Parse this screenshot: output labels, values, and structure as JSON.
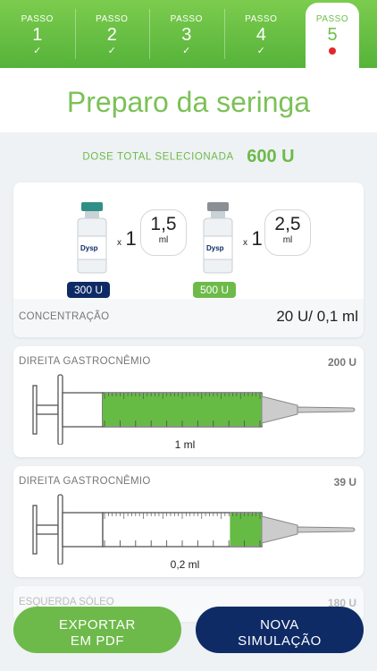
{
  "steps": [
    {
      "label": "PASSO",
      "number": "1",
      "mark": "✓"
    },
    {
      "label": "PASSO",
      "number": "2",
      "mark": "✓"
    },
    {
      "label": "PASSO",
      "number": "3",
      "mark": "✓"
    },
    {
      "label": "PASSO",
      "number": "4",
      "mark": "✓"
    },
    {
      "label": "PASSO",
      "number": "5"
    }
  ],
  "title": "Preparo da seringa",
  "dose": {
    "label": "DOSE TOTAL SELECIONADA",
    "value": "600 U"
  },
  "vials": [
    {
      "badge": "300 U",
      "badge_color": "#0f2b66",
      "cap_color": "#2f8f86",
      "x": "x",
      "count": "1",
      "volume": "1,5",
      "unit": "ml"
    },
    {
      "badge": "500 U",
      "badge_color": "#6dba4a",
      "cap_color": "#8a8f94",
      "x": "x",
      "count": "1",
      "volume": "2,5",
      "unit": "ml"
    }
  ],
  "concentration": {
    "label": "CONCENTRAÇÃO",
    "value": "20 U/ 0,1 ml"
  },
  "syringes": [
    {
      "muscle": "DIREITA GASTROCNÊMIO",
      "dose": "200 U",
      "volume": "1 ml",
      "fill_fraction": 1.0
    },
    {
      "muscle": "DIREITA GASTROCNÊMIO",
      "dose": "39 U",
      "volume": "0,2 ml",
      "fill_fraction": 0.2
    }
  ],
  "next_item": {
    "muscle": "ESQUERDA SÓLEO",
    "dose": "180 U"
  },
  "buttons": {
    "export_line1": "EXPORTAR",
    "export_line2": "EM PDF",
    "new_line1": "NOVA",
    "new_line2": "SIMULAÇÃO"
  },
  "colors": {
    "accent_green": "#6dba4a",
    "navy": "#0f2b66",
    "step_active_dot": "#e3262b"
  }
}
